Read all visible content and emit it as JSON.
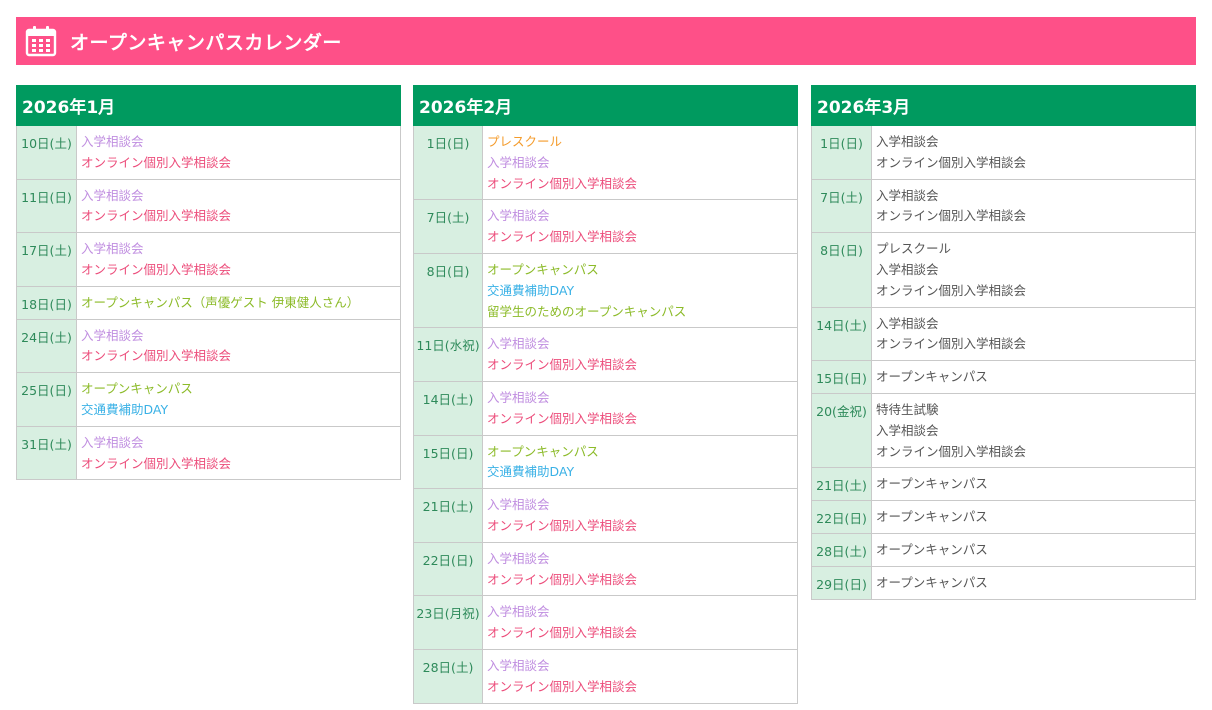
{
  "header": {
    "title": "オープンキャンパスカレンダー",
    "icon": "calendar-icon",
    "color": "#fe5088"
  },
  "colors": {
    "month_header": "#009a5f",
    "date_cell": "#d8efe1",
    "nyugaku": "#c08ee0",
    "online": "#ec4d7b",
    "open": "#8cbb29",
    "kotsu": "#3ab1e6",
    "pre": "#f49b2b",
    "plain": "#555555"
  },
  "months": [
    {
      "title": "2026年1月",
      "days": [
        {
          "date": "10日(土)",
          "events": [
            {
              "text": "入学相談会",
              "kind": "nyugaku"
            },
            {
              "text": "オンライン個別入学相談会",
              "kind": "online"
            }
          ]
        },
        {
          "date": "11日(日)",
          "events": [
            {
              "text": "入学相談会",
              "kind": "nyugaku"
            },
            {
              "text": "オンライン個別入学相談会",
              "kind": "online"
            }
          ]
        },
        {
          "date": "17日(土)",
          "events": [
            {
              "text": "入学相談会",
              "kind": "nyugaku"
            },
            {
              "text": "オンライン個別入学相談会",
              "kind": "online"
            }
          ]
        },
        {
          "date": "18日(日)",
          "events": [
            {
              "text": "オープンキャンパス（声優ゲスト 伊東健人さん）",
              "kind": "open"
            }
          ]
        },
        {
          "date": "24日(土)",
          "events": [
            {
              "text": "入学相談会",
              "kind": "nyugaku"
            },
            {
              "text": "オンライン個別入学相談会",
              "kind": "online"
            }
          ]
        },
        {
          "date": "25日(日)",
          "events": [
            {
              "text": "オープンキャンパス",
              "kind": "open"
            },
            {
              "text": "交通費補助DAY",
              "kind": "kotsu"
            }
          ]
        },
        {
          "date": "31日(土)",
          "events": [
            {
              "text": "入学相談会",
              "kind": "nyugaku"
            },
            {
              "text": "オンライン個別入学相談会",
              "kind": "online"
            }
          ]
        }
      ]
    },
    {
      "title": "2026年2月",
      "days": [
        {
          "date": "1日(日)",
          "events": [
            {
              "text": "プレスクール",
              "kind": "pre"
            },
            {
              "text": "入学相談会",
              "kind": "nyugaku"
            },
            {
              "text": "オンライン個別入学相談会",
              "kind": "online"
            }
          ]
        },
        {
          "date": "7日(土)",
          "events": [
            {
              "text": "入学相談会",
              "kind": "nyugaku"
            },
            {
              "text": "オンライン個別入学相談会",
              "kind": "online"
            }
          ]
        },
        {
          "date": "8日(日)",
          "events": [
            {
              "text": "オープンキャンパス",
              "kind": "open"
            },
            {
              "text": "交通費補助DAY",
              "kind": "kotsu"
            },
            {
              "text": "留学生のためのオープンキャンパス",
              "kind": "ryugaku"
            }
          ]
        },
        {
          "date": "11日(水祝)",
          "events": [
            {
              "text": "入学相談会",
              "kind": "nyugaku"
            },
            {
              "text": "オンライン個別入学相談会",
              "kind": "online"
            }
          ]
        },
        {
          "date": "14日(土)",
          "events": [
            {
              "text": "入学相談会",
              "kind": "nyugaku"
            },
            {
              "text": "オンライン個別入学相談会",
              "kind": "online"
            }
          ]
        },
        {
          "date": "15日(日)",
          "events": [
            {
              "text": "オープンキャンパス",
              "kind": "open"
            },
            {
              "text": "交通費補助DAY",
              "kind": "kotsu"
            }
          ]
        },
        {
          "date": "21日(土)",
          "events": [
            {
              "text": "入学相談会",
              "kind": "nyugaku"
            },
            {
              "text": "オンライン個別入学相談会",
              "kind": "online"
            }
          ]
        },
        {
          "date": "22日(日)",
          "events": [
            {
              "text": "入学相談会",
              "kind": "nyugaku"
            },
            {
              "text": "オンライン個別入学相談会",
              "kind": "online"
            }
          ]
        },
        {
          "date": "23日(月祝)",
          "events": [
            {
              "text": "入学相談会",
              "kind": "nyugaku"
            },
            {
              "text": "オンライン個別入学相談会",
              "kind": "online"
            }
          ]
        },
        {
          "date": "28日(土)",
          "events": [
            {
              "text": "入学相談会",
              "kind": "nyugaku"
            },
            {
              "text": "オンライン個別入学相談会",
              "kind": "online"
            }
          ]
        }
      ]
    },
    {
      "title": "2026年3月",
      "days": [
        {
          "date": "1日(日)",
          "events": [
            {
              "text": "入学相談会",
              "kind": "plain"
            },
            {
              "text": "オンライン個別入学相談会",
              "kind": "plain"
            }
          ]
        },
        {
          "date": "7日(土)",
          "events": [
            {
              "text": "入学相談会",
              "kind": "plain"
            },
            {
              "text": "オンライン個別入学相談会",
              "kind": "plain"
            }
          ]
        },
        {
          "date": "8日(日)",
          "events": [
            {
              "text": "プレスクール",
              "kind": "plain"
            },
            {
              "text": "入学相談会",
              "kind": "plain"
            },
            {
              "text": "オンライン個別入学相談会",
              "kind": "plain"
            }
          ]
        },
        {
          "date": "14日(土)",
          "events": [
            {
              "text": "入学相談会",
              "kind": "plain"
            },
            {
              "text": "オンライン個別入学相談会",
              "kind": "plain"
            }
          ]
        },
        {
          "date": "15日(日)",
          "events": [
            {
              "text": "オープンキャンパス",
              "kind": "plain"
            }
          ]
        },
        {
          "date": "20(金祝)",
          "events": [
            {
              "text": "特待生試験",
              "kind": "plain"
            },
            {
              "text": "入学相談会",
              "kind": "plain"
            },
            {
              "text": "オンライン個別入学相談会",
              "kind": "plain"
            }
          ]
        },
        {
          "date": "21日(土)",
          "events": [
            {
              "text": "オープンキャンパス",
              "kind": "plain"
            }
          ]
        },
        {
          "date": "22日(日)",
          "events": [
            {
              "text": "オープンキャンパス",
              "kind": "plain"
            }
          ]
        },
        {
          "date": "28日(土)",
          "events": [
            {
              "text": "オープンキャンパス",
              "kind": "plain"
            }
          ]
        },
        {
          "date": "29日(日)",
          "events": [
            {
              "text": "オープンキャンパス",
              "kind": "plain"
            }
          ]
        }
      ]
    }
  ]
}
